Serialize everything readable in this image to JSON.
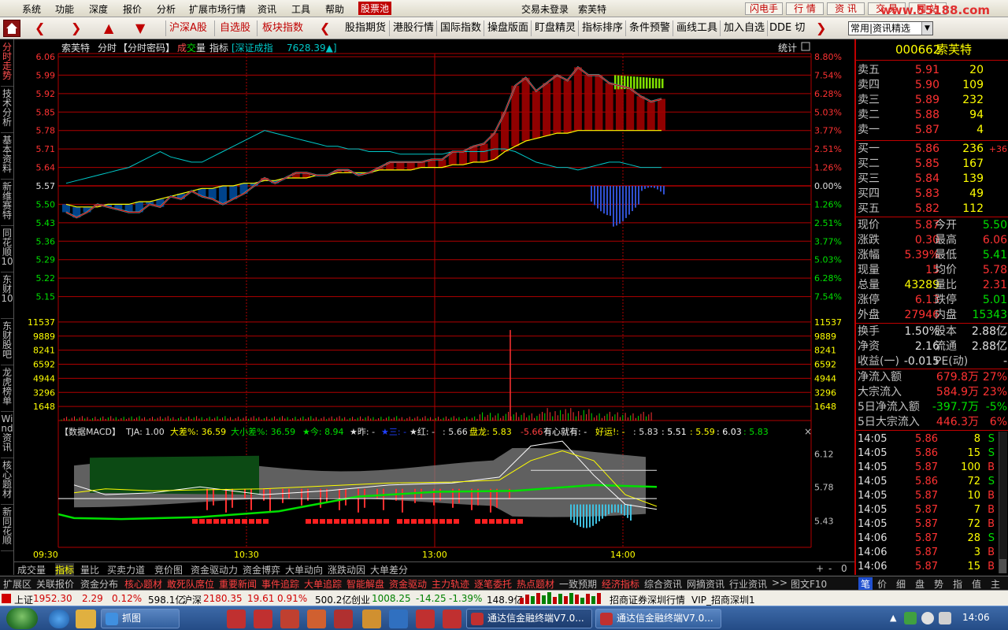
{
  "menu": {
    "items": [
      "系统",
      "功能",
      "深度",
      "报价",
      "分析",
      "扩展市场行情",
      "资讯",
      "工具",
      "帮助",
      "股票池"
    ],
    "login": "交易未登录",
    "stock_name": "索芙特",
    "right_buttons": [
      "闪电手",
      "行 情",
      "资 讯",
      "交 易",
      "网 站"
    ],
    "watermark": "www.55188.com"
  },
  "toolbar": {
    "items": [
      "沪深A股",
      "自选股",
      "板块指数",
      "股指期货",
      "港股行情",
      "国际指数",
      "操盘版面",
      "盯盘精灵",
      "指标排序",
      "条件预警",
      "画线工具",
      "加入自选",
      "DDE 切"
    ],
    "select_value": "常用|资讯精选"
  },
  "leftnav": {
    "tabs": [
      "分时走势",
      "技术分析",
      "基本资料",
      "新维赛特",
      "同花顺10",
      "东财10",
      "东财股吧",
      "龙虎榜单",
      "Wind资讯",
      "核心题材",
      "新同花顺"
    ]
  },
  "chart_header": {
    "stock": "索芙特",
    "mode": "分时",
    "code_tag": "【分时密码】",
    "cheng": "成",
    "jiao": "交",
    "liang": "量",
    "indicator": "指标",
    "index_name": "[深证成指",
    "index_value": "7628.39▲]",
    "stats": "统计"
  },
  "macd_header": {
    "name": "【数据MACD】",
    "tja": "TJA: 1.00",
    "dacha": "大差%: 36.59",
    "xiaocha": "大小差%: 36.59",
    "jin": "★今: 8.94",
    "zuo": "★昨: -",
    "san": "★三: -",
    "hong": "★红: -",
    "v566": ": 5.66",
    "panlong": "盘龙: 5.83",
    "neg": "-5.66",
    "youxin": "有心就有: -",
    "haoyun": "好运!: -",
    "v583": ": 5.83",
    "v551": ": 5.51",
    "v559": ": 5.59",
    "v603": ": 6.03",
    "v583b": ": 5.83"
  },
  "chart_data": [
    {
      "type": "line",
      "name": "intraday-price",
      "x": [
        "09:30",
        "10:30",
        "13:00",
        "14:00"
      ],
      "y_axis_left": [
        "6.06",
        "5.99",
        "5.92",
        "5.85",
        "5.78",
        "5.71",
        "5.64",
        "5.57",
        "5.50",
        "5.43",
        "5.36",
        "5.29",
        "5.22",
        "5.15"
      ],
      "y_axis_right": [
        "8.80%",
        "7.54%",
        "6.28%",
        "5.03%",
        "3.77%",
        "2.51%",
        "1.26%",
        "0.00%",
        "1.26%",
        "2.51%",
        "3.77%",
        "5.03%",
        "6.28%",
        "7.54%"
      ],
      "ylim": [
        5.08,
        6.06
      ],
      "prev_close": 5.57,
      "price": [
        5.47,
        5.45,
        5.47,
        5.5,
        5.49,
        5.48,
        5.47,
        5.47,
        5.5,
        5.49,
        5.53,
        5.52,
        5.55,
        5.53,
        5.52,
        5.5,
        5.52,
        5.54,
        5.57,
        5.6,
        5.58,
        5.6,
        5.62,
        5.62,
        5.61,
        5.61,
        5.63,
        5.63,
        5.61,
        5.62,
        5.64,
        5.66,
        5.66,
        5.66,
        5.66,
        5.67,
        5.67,
        5.7,
        5.7,
        5.72,
        5.73,
        5.77,
        5.85,
        5.95,
        5.98,
        5.93,
        5.96,
        5.99,
        5.97,
        6.02,
        5.99,
        5.99,
        5.96,
        5.95,
        5.94,
        5.91,
        5.89,
        5.9
      ],
      "avg": [
        5.5,
        5.49,
        5.49,
        5.49,
        5.5,
        5.5,
        5.5,
        5.51,
        5.51,
        5.52,
        5.53,
        5.54,
        5.55,
        5.56,
        5.56,
        5.57,
        5.57,
        5.58,
        5.58,
        5.59,
        5.59,
        5.6,
        5.6,
        5.6,
        5.61,
        5.61,
        5.62,
        5.62,
        5.62,
        5.62,
        5.63,
        5.63,
        5.63,
        5.63,
        5.64,
        5.64,
        5.64,
        5.65,
        5.65,
        5.66,
        5.66,
        5.67,
        5.7,
        5.72,
        5.74,
        5.75,
        5.76,
        5.77,
        5.77,
        5.78,
        5.78,
        5.78,
        5.78,
        5.78,
        5.78,
        5.78,
        5.78,
        5.78
      ],
      "index_line": [
        5.58,
        5.59,
        5.6,
        5.61,
        5.62,
        5.63,
        5.64,
        5.66,
        5.68,
        5.7,
        5.68,
        5.67,
        5.66,
        5.66,
        5.68,
        5.7,
        5.72,
        5.74,
        5.76,
        5.78,
        5.77,
        5.76,
        5.75,
        5.74,
        5.73,
        5.72,
        5.72,
        5.71,
        5.71,
        5.7,
        5.7,
        5.7,
        5.69,
        5.69,
        5.69,
        5.69,
        5.69,
        5.7,
        5.7,
        5.7,
        5.7,
        5.71,
        5.71,
        5.7,
        5.68,
        5.66,
        5.65,
        5.64,
        5.64,
        5.63,
        5.64,
        5.65,
        5.66,
        5.66,
        5.65,
        5.64,
        5.64,
        5.64
      ]
    },
    {
      "type": "bar",
      "name": "volume",
      "y_axis": [
        "11537",
        "9889",
        "8241",
        "6592",
        "4944",
        "3296",
        "1648"
      ],
      "ylim": [
        0,
        12360
      ],
      "spike_time": "13:50",
      "spike_value": 10600
    },
    {
      "type": "line",
      "name": "macd-panel",
      "y_axis_right": [
        "6.12",
        "5.78",
        "5.43"
      ],
      "ylim": [
        5.2,
        6.3
      ]
    }
  ],
  "quote": {
    "code": "000662",
    "name": "索芙特",
    "asks": [
      {
        "label": "卖五",
        "price": "5.91",
        "vol": "20"
      },
      {
        "label": "卖四",
        "price": "5.90",
        "vol": "109"
      },
      {
        "label": "卖三",
        "price": "5.89",
        "vol": "232"
      },
      {
        "label": "卖二",
        "price": "5.88",
        "vol": "94"
      },
      {
        "label": "卖一",
        "price": "5.87",
        "vol": "4"
      }
    ],
    "bids": [
      {
        "label": "买一",
        "price": "5.86",
        "vol": "236",
        "extra": "+36"
      },
      {
        "label": "买二",
        "price": "5.85",
        "vol": "167",
        "extra": ""
      },
      {
        "label": "买三",
        "price": "5.84",
        "vol": "139",
        "extra": ""
      },
      {
        "label": "买四",
        "price": "5.83",
        "vol": "49",
        "extra": ""
      },
      {
        "label": "买五",
        "price": "5.82",
        "vol": "112",
        "extra": ""
      }
    ],
    "stats": [
      {
        "l1": "现价",
        "v1": "5.87",
        "c1": "red",
        "l2": "今开",
        "v2": "5.50",
        "c2": "green"
      },
      {
        "l1": "涨跌",
        "v1": "0.30",
        "c1": "red",
        "l2": "最高",
        "v2": "6.06",
        "c2": "red"
      },
      {
        "l1": "涨幅",
        "v1": "5.39%",
        "c1": "red",
        "l2": "最低",
        "v2": "5.41",
        "c2": "green"
      },
      {
        "l1": "现量",
        "v1": "15",
        "c1": "red",
        "l2": "均价",
        "v2": "5.78",
        "c2": "red"
      },
      {
        "l1": "总量",
        "v1": "43289",
        "c1": "yellow",
        "l2": "量比",
        "v2": "2.31",
        "c2": "red"
      },
      {
        "l1": "涨停",
        "v1": "6.13",
        "c1": "red",
        "l2": "跌停",
        "v2": "5.01",
        "c2": "green"
      },
      {
        "l1": "外盘",
        "v1": "27946",
        "c1": "red",
        "l2": "内盘",
        "v2": "15343",
        "c2": "green"
      }
    ],
    "stats2": [
      {
        "l1": "换手",
        "v1": "1.50%",
        "c1": "white",
        "l2": "股本",
        "v2": "2.88亿",
        "c2": "white"
      },
      {
        "l1": "净资",
        "v1": "2.16",
        "c1": "white",
        "l2": "流通",
        "v2": "2.88亿",
        "c2": "white"
      },
      {
        "l1": "收益(一)",
        "v1": "-0.015",
        "c1": "white",
        "l2": "PE(动)",
        "v2": "-",
        "c2": "white"
      }
    ],
    "flows": [
      {
        "label": "净流入额",
        "value": "679.8万",
        "pct": "27%",
        "c": "red"
      },
      {
        "label": "大宗流入",
        "value": "584.9万",
        "pct": "23%",
        "c": "red"
      },
      {
        "label": "5日净流入额",
        "value": "-397.7万",
        "pct": "-5%",
        "c": "green"
      },
      {
        "label": "5日大宗流入",
        "value": "446.3万",
        "pct": "6%",
        "c": "red"
      }
    ],
    "ticks": [
      {
        "t": "14:05",
        "p": "5.86",
        "v": "8",
        "d": "S"
      },
      {
        "t": "14:05",
        "p": "5.86",
        "v": "15",
        "d": "S"
      },
      {
        "t": "14:05",
        "p": "5.87",
        "v": "100",
        "d": "B"
      },
      {
        "t": "14:05",
        "p": "5.86",
        "v": "72",
        "d": "S"
      },
      {
        "t": "14:05",
        "p": "5.87",
        "v": "10",
        "d": "B"
      },
      {
        "t": "14:05",
        "p": "5.87",
        "v": "7",
        "d": "B"
      },
      {
        "t": "14:05",
        "p": "5.87",
        "v": "72",
        "d": "B"
      },
      {
        "t": "14:06",
        "p": "5.87",
        "v": "28",
        "d": "S"
      },
      {
        "t": "14:06",
        "p": "5.87",
        "v": "3",
        "d": "B"
      },
      {
        "t": "14:06",
        "p": "5.87",
        "v": "15",
        "d": "B"
      }
    ]
  },
  "tabs_bottom1": [
    "成交量",
    "指标",
    "量比",
    "买卖力道",
    "竞价图",
    "资金驱动力",
    "资金博弈",
    "大单动向",
    "涨跌动因",
    "大单差分"
  ],
  "tabs_bottom1_ctrl": [
    "+",
    "-",
    "0"
  ],
  "tabs_bottom2": [
    "扩展区",
    "关联报价",
    "资金分布",
    "核心题材",
    "敢死队席位",
    "重要新闻",
    "事件追踪",
    "大单追踪",
    "智能解盘",
    "资金驱动",
    "主力轨迹",
    "逐笔委托",
    "热点题材",
    "一致预期",
    "经济指标",
    "综合资讯",
    "网摘资讯",
    "行业资讯",
    ">>",
    "图文F10"
  ],
  "tabs_right2": [
    "笔",
    "价",
    "细",
    "盘",
    "势",
    "指",
    "值",
    "主"
  ],
  "status": {
    "sh_name": "上证",
    "sh_val": "1952.30",
    "sh_chg": "2.29",
    "sh_pct": "0.12%",
    "sh_amt": "598.1亿",
    "hs_name": "沪深",
    "hs_val": "2180.35",
    "hs_chg": "19.61",
    "hs_pct": "0.91%",
    "hs_amt": "500.2亿",
    "cy_name": "创业",
    "cy_val": "1008.25",
    "cy_chg": "-14.25",
    "cy_pct": "-1.39%",
    "cy_amt": "148.9亿",
    "broker": "招商证券深圳行情",
    "vip": "VIP_招商深圳1"
  },
  "taskbar": {
    "items": [
      "抓图",
      "通达信金融终端V7.0...",
      "通达信金融终端V7.0..."
    ],
    "clock": "14:06"
  },
  "time_axis": [
    "09:30",
    "10:30",
    "13:00",
    "14:00"
  ],
  "colors": {
    "up": "#ff3232",
    "down": "#00e000",
    "grid": "#b00000",
    "price": "#ffffff",
    "avg": "#ffff00",
    "index": "#00c8c8"
  }
}
